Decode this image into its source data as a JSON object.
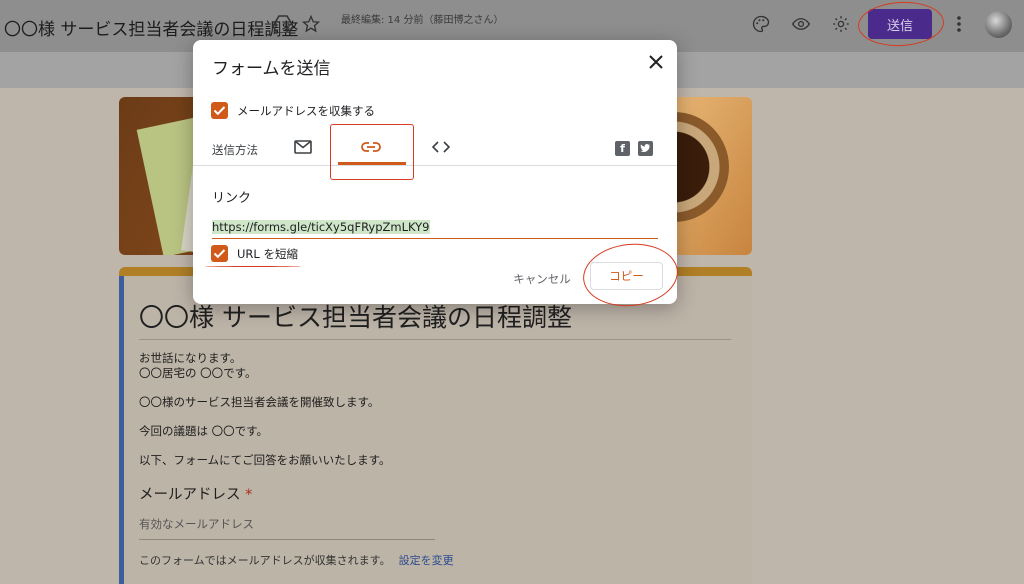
{
  "topbar": {
    "title": "〇〇様 サービス担当者会議の日程調整",
    "last_edited": "最終編集: 14 分前（藤田博之さん）",
    "send_label": "送信"
  },
  "form": {
    "title": "〇〇様 サービス担当者会議の日程調整",
    "description": "お世話になります。\n〇〇居宅の 〇〇です。\n\n〇〇様のサービス担当者会議を開催致します。\n\n今回の議題は 〇〇です。\n\n以下、フォームにてご回答をお願いいたします。",
    "question_label": "メールアドレス",
    "required_mark": "*",
    "question_placeholder": "有効なメールアドレス",
    "collect_note": "このフォームではメールアドレスが収集されます。",
    "change_settings": "設定を変更"
  },
  "dialog": {
    "title": "フォームを送信",
    "close": "✕",
    "collect_email_label": "メールアドレスを収集する",
    "send_method_label": "送信方法",
    "link_heading": "リンク",
    "link_url": "https://forms.gle/ticXy5qFRypZmLKY9",
    "shorten_url_label": "URL を短縮",
    "cancel_label": "キャンセル",
    "copy_label": "コピー",
    "facebook_glyph": "f"
  },
  "colors": {
    "accent": "#cf5a1a",
    "send_button": "#4a2a8a",
    "annotation": "#d63b21"
  }
}
